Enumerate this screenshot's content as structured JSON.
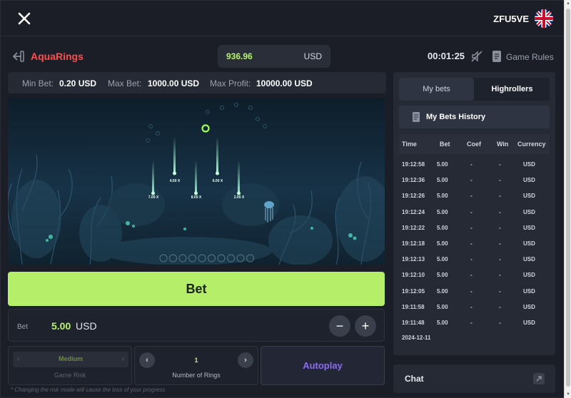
{
  "header": {
    "username": "ZFU5VE",
    "flag_icon": "uk-flag-icon"
  },
  "game": {
    "title": "AquaRings",
    "balance": "936.96",
    "currency": "USD",
    "timer": "00:01:25",
    "rules_label": "Game Rules"
  },
  "limits": {
    "min_label": "Min Bet:",
    "min_value": "0.20 USD",
    "max_label": "Max Bet:",
    "max_value": "1000.00 USD",
    "profit_label": "Max Profit:",
    "profit_value": "10000.00 USD"
  },
  "scene": {
    "multipliers": [
      "7.00 X",
      "4.00 X",
      "8.00 X",
      "6.00 X",
      "2.00 X"
    ],
    "ring_slots": 10
  },
  "controls": {
    "bet_button": "Bet",
    "bet_label": "Bet",
    "bet_value": "5.00",
    "bet_currency": "USD",
    "minus": "−",
    "plus": "+",
    "risk_value": "Medium",
    "risk_label": "Game Risk",
    "rings_value": "1",
    "rings_label": "Number of Rings",
    "autoplay": "Autoplay",
    "note": "* Changing the risk mode will cause the loss of your progress"
  },
  "side": {
    "tabs": [
      "My bets",
      "Highrollers"
    ],
    "history_label": "My Bets History",
    "columns": [
      "Time",
      "Bet",
      "Coef",
      "Win",
      "Currency"
    ],
    "rows": [
      [
        "19:12:58",
        "5.00",
        "-",
        "-",
        "USD"
      ],
      [
        "19:12:36",
        "5.00",
        "-",
        "-",
        "USD"
      ],
      [
        "19:12:26",
        "5.00",
        "-",
        "-",
        "USD"
      ],
      [
        "19:12:24",
        "5.00",
        "-",
        "-",
        "USD"
      ],
      [
        "19:12:22",
        "5.00",
        "-",
        "-",
        "USD"
      ],
      [
        "19:12:18",
        "5.00",
        "-",
        "-",
        "USD"
      ],
      [
        "19:12:13",
        "5.00",
        "-",
        "-",
        "USD"
      ],
      [
        "19:12:10",
        "5.00",
        "-",
        "-",
        "USD"
      ],
      [
        "19:12:05",
        "5.00",
        "-",
        "-",
        "USD"
      ],
      [
        "19:11:58",
        "5.00",
        "-",
        "-",
        "USD"
      ],
      [
        "19:11:48",
        "5.00",
        "-",
        "-",
        "USD"
      ]
    ],
    "date": "2024-12-11",
    "chat_label": "Chat"
  },
  "colors": {
    "accent_green": "#b5ef6a",
    "brand_red": "#ff4d4d",
    "autoplay_purple": "#8b6cf0"
  }
}
